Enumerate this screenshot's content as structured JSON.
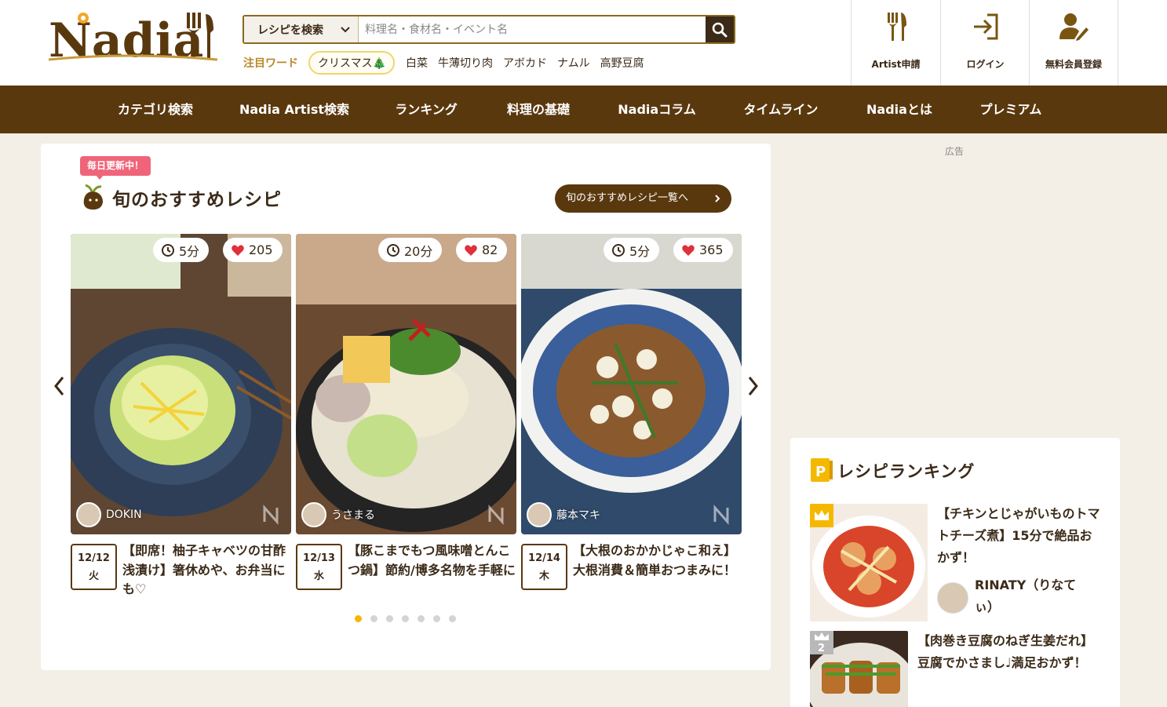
{
  "header": {
    "logo_text": "Nadia",
    "search": {
      "select_label": "レシピを検索",
      "placeholder": "料理名・食材名・イベント名"
    },
    "trending": {
      "label": "注目ワード",
      "highlight": "クリスマス🎄",
      "words": [
        "白菜",
        "牛薄切り肉",
        "アボカド",
        "ナムル",
        "高野豆腐"
      ]
    },
    "nav": [
      {
        "label": "Artist申請",
        "icon": "fork-knife-icon"
      },
      {
        "label": "ログイン",
        "icon": "login-icon"
      },
      {
        "label": "無料会員登録",
        "icon": "user-edit-icon"
      }
    ]
  },
  "main_nav": [
    "カテゴリ検索",
    "Nadia Artist検索",
    "ランキング",
    "料理の基礎",
    "Nadiaコラム",
    "タイムライン",
    "Nadiaとは",
    "プレミアム"
  ],
  "featured": {
    "badge": "毎日更新中！",
    "title": "旬のおすすめレシピ",
    "more_label": "旬のおすすめレシピ一覧へ",
    "recipes": [
      {
        "time": "5分",
        "likes": "205",
        "author": "DOKIN",
        "date": "12/12",
        "day": "火",
        "title": "【即席！柚子キャベツの甘酢浅漬け】箸休めや、お弁当にも♡"
      },
      {
        "time": "20分",
        "likes": "82",
        "author": "うさまる",
        "date": "12/13",
        "day": "水",
        "title": "【豚こまでもつ風味噌とんこつ鍋】節約/博多名物を手軽に"
      },
      {
        "time": "5分",
        "likes": "365",
        "author": "藤本マキ",
        "date": "12/14",
        "day": "木",
        "title": "【大根のおかかじゃこ和え】大根消費＆簡単おつまみに！"
      }
    ],
    "pager": {
      "count": 7,
      "active": 1
    }
  },
  "ad_label": "広告",
  "ranking": {
    "title": "レシピランキング",
    "items": [
      {
        "rank": "1",
        "title": "【チキンとじゃがいものトマトチーズ煮】15分で絶品おかず！",
        "author": "RINATY（りなてぃ）"
      },
      {
        "rank": "2",
        "title": "【肉巻き豆腐のねぎ生姜だれ】豆腐でかさまし♩満足おかず！"
      }
    ]
  },
  "colors": {
    "brand_brown": "#5a380e",
    "accent_gold": "#b8892a",
    "badge_pink": "#f0647a",
    "pager_active": "#f5b800"
  }
}
